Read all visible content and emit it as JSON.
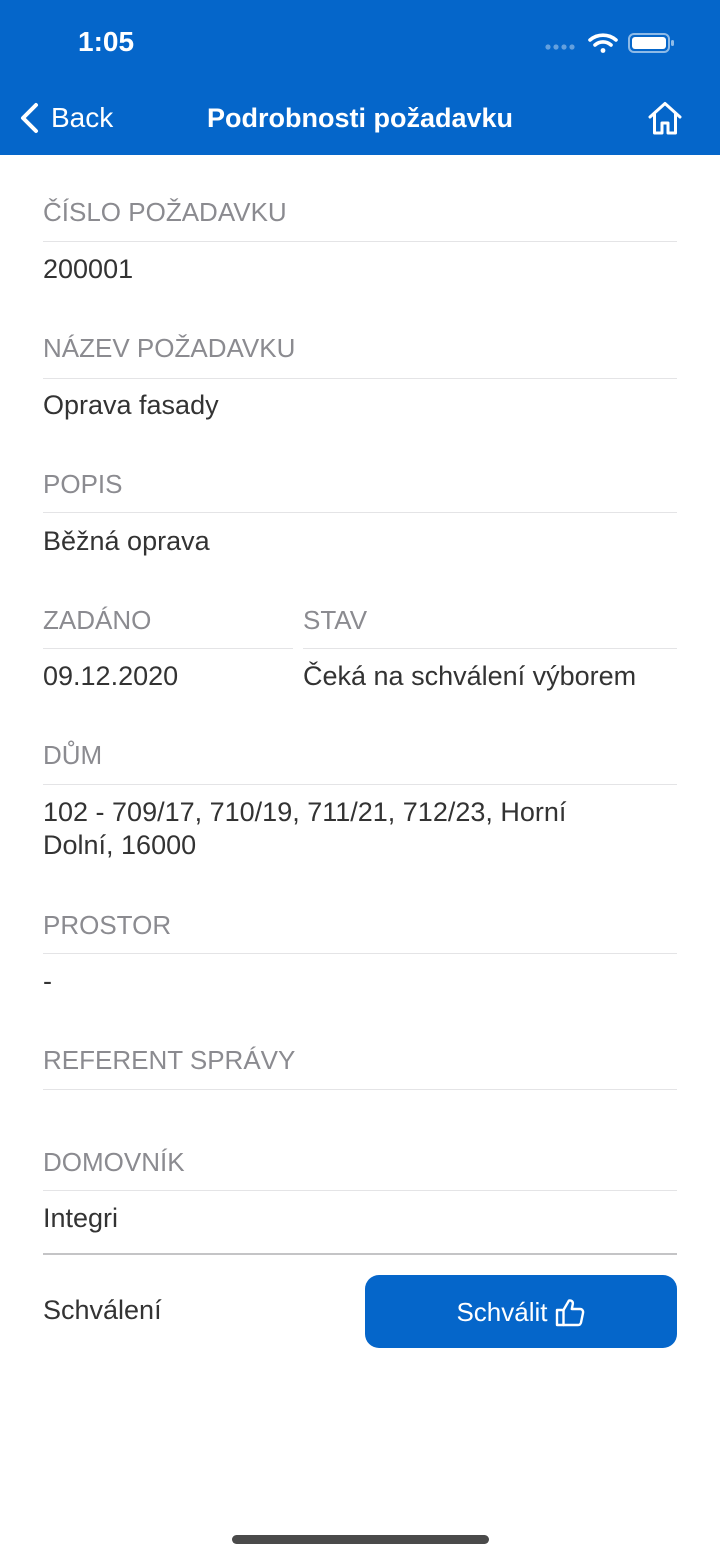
{
  "status_bar": {
    "time": "1:05",
    "icons": [
      "signal-icon",
      "wifi-icon",
      "battery-icon"
    ]
  },
  "nav": {
    "back_label": "Back",
    "back_icon": "chevron-left-icon",
    "title": "Podrobnosti požadavku",
    "home_icon": "home-icon"
  },
  "fields": {
    "request_number": {
      "label": "ČÍSLO POŽADAVKU",
      "value": "200001"
    },
    "request_name": {
      "label": "NÁZEV POŽADAVKU",
      "value": "Oprava fasady"
    },
    "description": {
      "label": "POPIS",
      "value": "Běžná oprava"
    },
    "submitted": {
      "label": "ZADÁNO",
      "value": "09.12.2020"
    },
    "status": {
      "label": "STAV",
      "value": "Čeká na schválení výborem"
    },
    "house": {
      "label": "DŮM",
      "value": "102 - 709/17, 710/19, 711/21, 712/23, Horní Dolní, 16000"
    },
    "space": {
      "label": "PROSTOR",
      "value": "-"
    },
    "property_manager": {
      "label": "REFERENT SPRÁVY"
    },
    "caretaker": {
      "label": "DOMOVNÍK",
      "value": "Integri"
    }
  },
  "approval": {
    "label": "Schválení",
    "button_label": "Schválit",
    "button_icon": "thumbs-up-icon"
  },
  "colors": {
    "primary": "#0566CA",
    "label": "#8B8B90",
    "value": "#333333"
  }
}
